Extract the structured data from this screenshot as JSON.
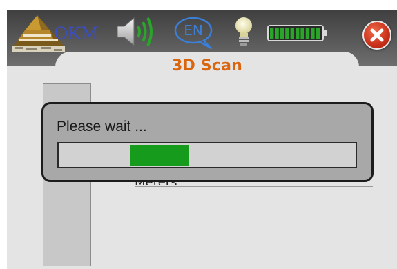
{
  "header": {
    "logo_text": "OKM",
    "language_code": "EN",
    "battery_level": 1.0,
    "icons": [
      "logo-pyramid-icon",
      "speaker-volume-icon",
      "language-bubble-icon",
      "light-bulb-icon",
      "battery-icon",
      "close-icon"
    ]
  },
  "page": {
    "title": "3D Scan"
  },
  "form": {
    "unit_value": "Meters"
  },
  "dialog": {
    "message": "Please wait ...",
    "progress_block_start": 0.24,
    "progress_block_end": 0.44
  },
  "colors": {
    "title": "#d9650f",
    "progress": "#169b1d",
    "close_button": "#c9301a",
    "logo_text": "#3b4ec0",
    "language": "#3b7fd6",
    "battery": "#2aa52a",
    "speaker_waves": "#2aa52a"
  }
}
